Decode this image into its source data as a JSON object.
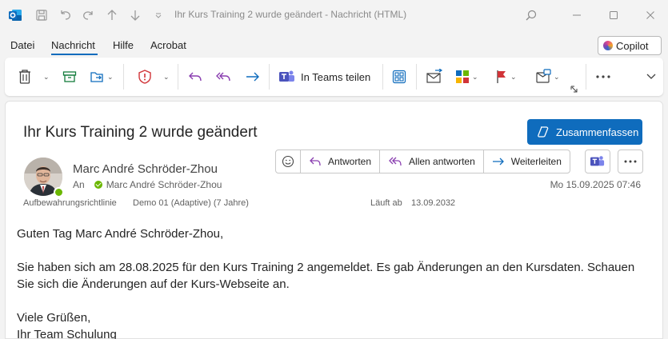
{
  "window": {
    "title": "Ihr Kurs Training 2 wurde geändert  -  Nachricht (HTML)",
    "app_icon": "outlook-icon"
  },
  "menu": {
    "items": [
      {
        "label": "Datei",
        "active": false
      },
      {
        "label": "Nachricht",
        "active": true
      },
      {
        "label": "Hilfe",
        "active": false
      },
      {
        "label": "Acrobat",
        "active": false
      }
    ],
    "copilot_label": "Copilot"
  },
  "ribbon": {
    "teams_share_label": "In Teams teilen"
  },
  "message": {
    "subject": "Ihr Kurs Training 2 wurde geändert",
    "summarize_label": "Zusammenfassen",
    "sender": "Marc André Schröder-Zhou",
    "to_prefix": "An",
    "to_name": "Marc André Schröder-Zhou",
    "actions": {
      "reply": "Antworten",
      "reply_all": "Allen antworten",
      "forward": "Weiterleiten"
    },
    "date": "Mo 15.09.2025 07:46",
    "retention_label": "Aufbewahrungsrichtlinie",
    "retention_value": "Demo 01 (Adaptive) (7 Jahre)",
    "expires_label": "Läuft ab",
    "expires_value": "13.09.2032",
    "body": {
      "greeting": "Guten Tag Marc André Schröder-Zhou,",
      "paragraph": "Sie haben sich am 28.08.2025 für den Kurs Training 2 angemeldet. Es gab Änderungen an den Kursdaten. Schauen Sie sich die Änderungen auf der Kurs-Webseite an.",
      "closing": "Viele Grüßen,",
      "signature": "Ihr Team Schulung"
    }
  },
  "colors": {
    "accent": "#0f6cbd",
    "presence": "#6bb700",
    "reply_purple": "#8a3fb0",
    "forward_blue": "#0f6cbd",
    "flag_red": "#d13438"
  }
}
